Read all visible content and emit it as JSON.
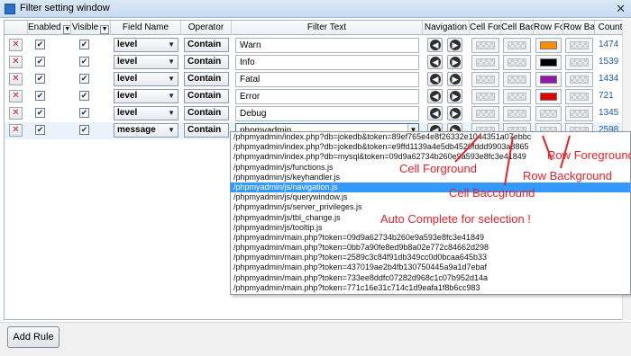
{
  "window": {
    "title": "Filter setting window"
  },
  "columns": {
    "enabled": "Enabled",
    "visible": "Visible",
    "field_name": "Field Name",
    "operator": "Operator",
    "filter_text": "Filter Text",
    "navigation": "Navigation",
    "cell_fg": "Cell For",
    "cell_bg": "Cell Bac",
    "row_fg": "Row For",
    "row_bg": "Row Bac",
    "count": "Count"
  },
  "icons": {
    "delete": "delete-rule-icon",
    "prev": "navigate-previous-icon",
    "next": "navigate-next-icon",
    "filter_dropdown": "filter-dropdown-icon"
  },
  "rows": [
    {
      "field": "level",
      "operator": "Contain",
      "text": "Warn",
      "row_fg": "#ff8c00",
      "count": "1474"
    },
    {
      "field": "level",
      "operator": "Contain",
      "text": "Info",
      "row_fg": "#000000",
      "count": "1539"
    },
    {
      "field": "level",
      "operator": "Contain",
      "text": "Fatal",
      "row_fg": "#8b1aa8",
      "count": "1434"
    },
    {
      "field": "level",
      "operator": "Contain",
      "text": "Error",
      "row_fg": "#e00000",
      "count": "721"
    },
    {
      "field": "level",
      "operator": "Contain",
      "text": "Debug",
      "row_fg": null,
      "count": "1345"
    },
    {
      "field": "message",
      "operator": "Contain",
      "text": "phpmyadmin",
      "row_fg": null,
      "count": "2598"
    }
  ],
  "autocomplete": [
    "/phpmyadmin/index.php?db=jokedb&token=89ef765e4e8f26332e1044351a07ebbc",
    "/phpmyadmin/index.php?db=jokedb&token=e9ffd1139a4e5db4520fddd9903a8865",
    "/phpmyadmin/index.php?db=mysql&token=09d9a62734b260e9a593e8fc3e41849",
    "/phpmyadmin/js/functions.js",
    "/phpmyadmin/js/keyhandler.js",
    "/phpmyadmin/js/navigation.js",
    "/phpmyadmin/js/querywindow.js",
    "/phpmyadmin/js/server_privileges.js",
    "/phpmyadmin/js/tbl_change.js",
    "/phpmyadmin/js/tooltip.js",
    "/phpmyadmin/main.php?token=09d9a62734b260e9a593e8fc3e41849",
    "/phpmyadmin/main.php?token=0bb7a90fe8ed9b8a02e772c84662d298",
    "/phpmyadmin/main.php?token=2589c3c84f91db349cc0d0bcaa645b33",
    "/phpmyadmin/main.php?token=437019ae2b4fb130750445a9a1d7ebaf",
    "/phpmyadmin/main.php?token=733ee8ddfc07282d968c1c07b952d14a",
    "/phpmyadmin/main.php?token=771c16e31c714c1d9eafa1f8b6cc983"
  ],
  "autocomplete_selected_index": 5,
  "annotations": {
    "cell_fg": "Cell Forground",
    "cell_bg": "Cell Baccground",
    "row_fg": "Row Foreground",
    "row_bg": "Row Background",
    "autocomplete": "Auto Complete for selection !"
  },
  "footer": {
    "add_rule": "Add Rule"
  }
}
